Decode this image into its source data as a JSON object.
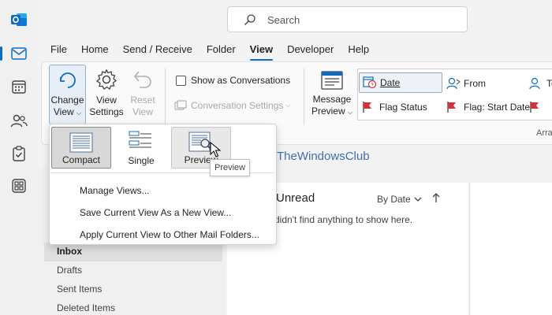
{
  "search": {
    "placeholder": "Search"
  },
  "menu": {
    "tabs": [
      {
        "label": "File"
      },
      {
        "label": "Home"
      },
      {
        "label": "Send / Receive"
      },
      {
        "label": "Folder"
      },
      {
        "label": "View",
        "active": true
      },
      {
        "label": "Developer"
      },
      {
        "label": "Help"
      }
    ]
  },
  "ribbon": {
    "change_view": {
      "line1": "Change",
      "line2": "View"
    },
    "view_settings": {
      "line1": "View",
      "line2": "Settings"
    },
    "reset_view": {
      "line1": "Reset",
      "line2": "View"
    },
    "show_as_conversations": "Show as Conversations",
    "conversation_settings": "Conversation Settings",
    "message_preview": {
      "line1": "Message",
      "line2": "Preview"
    },
    "arrangement": {
      "items": [
        {
          "label": "Date",
          "selected": true
        },
        {
          "label": "From"
        },
        {
          "label": "To"
        },
        {
          "label": "Flag Status"
        },
        {
          "label": "Flag: Start Date"
        }
      ],
      "group_label": "Arra"
    }
  },
  "change_view_menu": {
    "tiles": [
      {
        "label": "Compact",
        "state": "selected"
      },
      {
        "label": "Single",
        "state": "normal"
      },
      {
        "label": "Preview",
        "state": "hover"
      }
    ],
    "items": [
      {
        "label": "Manage Views..."
      },
      {
        "label": "Save Current View As a New View..."
      },
      {
        "label": "Apply Current View to Other Mail Folders..."
      }
    ],
    "tooltip": "Preview"
  },
  "watermark": "TheWindowsClub",
  "message_list": {
    "filter": "Unread",
    "sort": "By Date",
    "empty_text": "didn't find anything to show here."
  },
  "folders": [
    {
      "label": "Inbox",
      "selected": true
    },
    {
      "label": "Drafts"
    },
    {
      "label": "Sent Items"
    },
    {
      "label": "Deleted Items"
    }
  ],
  "colors": {
    "accent": "#0f6cbd",
    "outlook_blue": "#0f6cbd",
    "flag_red": "#d13438",
    "watermark_blue": "#3d6fb0"
  }
}
